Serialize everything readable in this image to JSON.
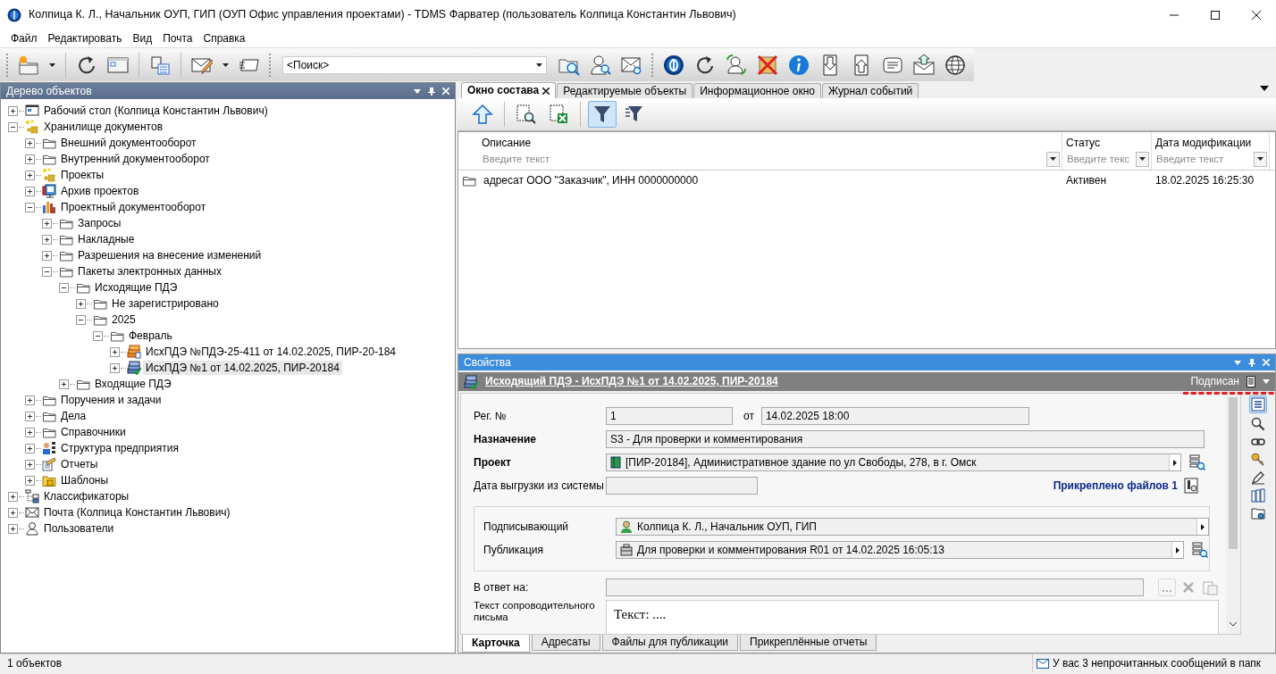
{
  "window": {
    "title": "Колпица К. Л., Начальник ОУП, ГИП (ОУП Офис управления проектами) - TDMS Фарватер (пользователь Колпица Константин Львович)"
  },
  "menu": [
    "Файл",
    "Редактировать",
    "Вид",
    "Почта",
    "Справка"
  ],
  "toolbar": {
    "search": {
      "value": "<Поиск>"
    }
  },
  "tree_panel": {
    "title": "Дерево объектов",
    "items": [
      {
        "label": "Рабочий стол (Колпица Константин Львович)",
        "kind": "desktop",
        "expanded": false,
        "selected": false
      },
      {
        "label": "Хранилище документов",
        "kind": "storage",
        "expanded": true,
        "selected": false,
        "children": [
          {
            "label": "Внешний документооборот",
            "kind": "folder",
            "expanded": false,
            "selected": false
          },
          {
            "label": "Внутренний документооборот",
            "kind": "folder",
            "expanded": false,
            "selected": false
          },
          {
            "label": "Проекты",
            "kind": "storage",
            "expanded": false,
            "selected": false
          },
          {
            "label": "Архив проектов",
            "kind": "archive",
            "expanded": false,
            "selected": false
          },
          {
            "label": "Проектный документооборот",
            "kind": "docflow",
            "expanded": true,
            "selected": false,
            "children": [
              {
                "label": "Запросы",
                "kind": "folder",
                "expanded": false,
                "selected": false
              },
              {
                "label": "Накладные",
                "kind": "folder",
                "expanded": false,
                "selected": false
              },
              {
                "label": "Разрешения на внесение изменений",
                "kind": "folder",
                "expanded": false,
                "selected": false
              },
              {
                "label": "Пакеты электронных данных",
                "kind": "folder",
                "expanded": true,
                "selected": false,
                "children": [
                  {
                    "label": "Исходящие ПДЭ",
                    "kind": "folder",
                    "expanded": true,
                    "selected": false,
                    "children": [
                      {
                        "label": "Не зарегистрировано",
                        "kind": "folder",
                        "expanded": false,
                        "selected": false
                      },
                      {
                        "label": "2025",
                        "kind": "folder",
                        "expanded": true,
                        "selected": false,
                        "children": [
                          {
                            "label": "Февраль",
                            "kind": "folder",
                            "expanded": true,
                            "selected": false,
                            "children": [
                              {
                                "label": "ИсхПДЭ №ПДЭ-25-411 от 14.02.2025, ПИР-20-184",
                                "kind": "package",
                                "expanded": false,
                                "selected": false
                              },
                              {
                                "label": "ИсхПДЭ №1 от 14.02.2025, ПИР-20184",
                                "kind": "signed",
                                "expanded": false,
                                "selected": true
                              }
                            ]
                          }
                        ]
                      }
                    ]
                  },
                  {
                    "label": "Входящие ПДЭ",
                    "kind": "folder",
                    "expanded": false,
                    "selected": false
                  }
                ]
              }
            ]
          },
          {
            "label": "Поручения и задачи",
            "kind": "folder",
            "expanded": false,
            "selected": false
          },
          {
            "label": "Дела",
            "kind": "folder",
            "expanded": false,
            "selected": false
          },
          {
            "label": "Справочники",
            "kind": "folder",
            "expanded": false,
            "selected": false
          },
          {
            "label": "Структура предприятия",
            "kind": "structure",
            "expanded": false,
            "selected": false
          },
          {
            "label": "Отчеты",
            "kind": "reports",
            "expanded": false,
            "selected": false
          },
          {
            "label": "Шаблоны",
            "kind": "templates",
            "expanded": false,
            "selected": false
          }
        ]
      },
      {
        "label": "Классификаторы",
        "kind": "classifier",
        "expanded": false,
        "selected": false
      },
      {
        "label": "Почта (Колпица Константин Львович)",
        "kind": "mail",
        "expanded": false,
        "selected": false
      },
      {
        "label": "Пользователи",
        "kind": "users",
        "expanded": false,
        "selected": false
      }
    ]
  },
  "tabs": [
    {
      "label": "Окно состава",
      "selected": true
    },
    {
      "label": "Редактируемые объекты",
      "selected": false
    },
    {
      "label": "Информационное окно",
      "selected": false
    },
    {
      "label": "Журнал событий",
      "selected": false
    }
  ],
  "list_toolbar": {
    "filter_on": true
  },
  "grid": {
    "columns": [
      {
        "label": "Описание",
        "filter_placeholder": "Введите текст"
      },
      {
        "label": "Статус",
        "filter_placeholder": "Введите текс"
      },
      {
        "label": "Дата модификации",
        "filter_placeholder": "Введите текст"
      }
    ],
    "rows": [
      {
        "cells": [
          "адресат ООО \"Заказчик\", ИНН 0000000000",
          "Активен",
          "18.02.2025 16:25:30"
        ]
      }
    ]
  },
  "properties": {
    "title": "Свойства",
    "object_link": "Исходящий ПДЭ - ИсхПДЭ №1 от 14.02.2025, ПИР-20184",
    "status": "Подписан",
    "reg_no": {
      "label": "Рег. №",
      "value": "1"
    },
    "reg_date": {
      "label": "от",
      "value": "14.02.2025 18:00"
    },
    "purpose": {
      "label": "Назначение",
      "value": "S3 - Для проверки и комментирования"
    },
    "project": {
      "label": "Проект",
      "value": "[ПИР-20184], Административное здание по ул Свободы, 278, в г. Омск"
    },
    "export_date": {
      "label": "Дата выгрузки из системы"
    },
    "attached_files": "Прикреплено файлов 1",
    "signer": {
      "label": "Подписывающий",
      "value": "Колпица К. Л., Начальник ОУП, ГИП"
    },
    "publication": {
      "label": "Публикация",
      "value": "Для проверки и комментирования R01 от 14.02.2025 16:05:13"
    },
    "reply_to": {
      "label": "В ответ на:"
    },
    "letter": {
      "label": "Текст сопроводительного письма",
      "value": "Текст: ...."
    },
    "tabs": [
      {
        "label": "Карточка",
        "selected": true
      },
      {
        "label": "Адресаты",
        "selected": false
      },
      {
        "label": "Файлы для публикации",
        "selected": false
      },
      {
        "label": "Прикреплённые отчеты",
        "selected": false
      }
    ]
  },
  "status_bar": {
    "objects": "1 объектов",
    "messages": "У вас 3 непрочитанных сообщений в папк"
  }
}
